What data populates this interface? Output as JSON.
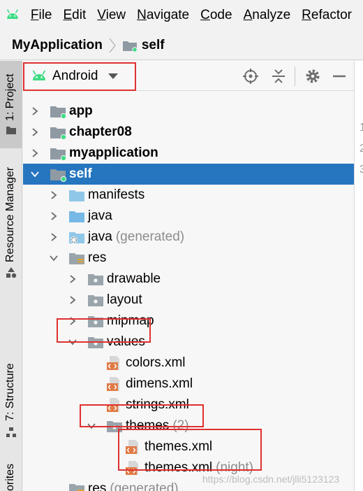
{
  "menu": {
    "items": [
      "File",
      "Edit",
      "View",
      "Navigate",
      "Code",
      "Analyze",
      "Refactor"
    ],
    "mnemonics": [
      "F",
      "E",
      "V",
      "N",
      "C",
      "A",
      "R"
    ]
  },
  "breadcrumb": {
    "project": "MyApplication",
    "module": "self"
  },
  "left_tabs": {
    "project": "1: Project",
    "resource_manager": "Resource Manager",
    "structure": "7: Structure",
    "favorites": "orites"
  },
  "panel": {
    "view_selector": "Android",
    "toolbar_icons": [
      "locate-icon",
      "collapse-all-icon",
      "gear-icon",
      "minimize-icon"
    ]
  },
  "tree": [
    {
      "label": "app",
      "bold": true,
      "icon": "module-folder-icon",
      "arrow": "right",
      "level": 0
    },
    {
      "label": "chapter08",
      "bold": true,
      "icon": "module-folder-icon",
      "arrow": "right",
      "level": 0
    },
    {
      "label": "myapplication",
      "bold": true,
      "icon": "module-folder-icon",
      "arrow": "right",
      "level": 0
    },
    {
      "label": "self",
      "bold": true,
      "icon": "module-folder-icon",
      "arrow": "down",
      "level": 0,
      "selected": true
    },
    {
      "label": "manifests",
      "icon": "folder-icon",
      "arrow": "right",
      "level": 1
    },
    {
      "label": "java",
      "icon": "source-folder-icon",
      "arrow": "right",
      "level": 1
    },
    {
      "label": "java",
      "suffix": "(generated)",
      "icon": "generated-folder-icon",
      "arrow": "right",
      "level": 1
    },
    {
      "label": "res",
      "icon": "resource-folder-icon",
      "arrow": "down",
      "level": 1
    },
    {
      "label": "drawable",
      "icon": "package-folder-icon",
      "arrow": "right",
      "level": 2
    },
    {
      "label": "layout",
      "icon": "package-folder-icon",
      "arrow": "right",
      "level": 2
    },
    {
      "label": "mipmap",
      "icon": "package-folder-icon",
      "arrow": "right",
      "level": 2
    },
    {
      "label": "values",
      "icon": "package-folder-icon",
      "arrow": "down",
      "level": 2
    },
    {
      "label": "colors.xml",
      "icon": "xml-file-icon",
      "arrow": "none",
      "level": 3
    },
    {
      "label": "dimens.xml",
      "icon": "xml-file-icon",
      "arrow": "none",
      "level": 3
    },
    {
      "label": "strings.xml",
      "icon": "xml-file-icon",
      "arrow": "none",
      "level": 3
    },
    {
      "label": "themes",
      "suffix": "(2)",
      "icon": "package-folder-icon",
      "arrow": "down",
      "level": 3
    },
    {
      "label": "themes.xml",
      "icon": "xml-file-icon",
      "arrow": "none",
      "level": 4
    },
    {
      "label": "themes.xml",
      "suffix": "(night)",
      "icon": "xml-file-icon",
      "arrow": "none",
      "level": 4
    },
    {
      "label": "res",
      "suffix": "(generated)",
      "icon": "resource-folder-icon",
      "arrow": "none",
      "level": 1
    }
  ],
  "gutter_numbers": [
    "1",
    "2",
    "3"
  ],
  "watermark": "https://blog.csdn.net/jlli5123123",
  "colors": {
    "selection": "#2675bf",
    "highlight": "#e03030",
    "android_green": "#3ddc84"
  }
}
